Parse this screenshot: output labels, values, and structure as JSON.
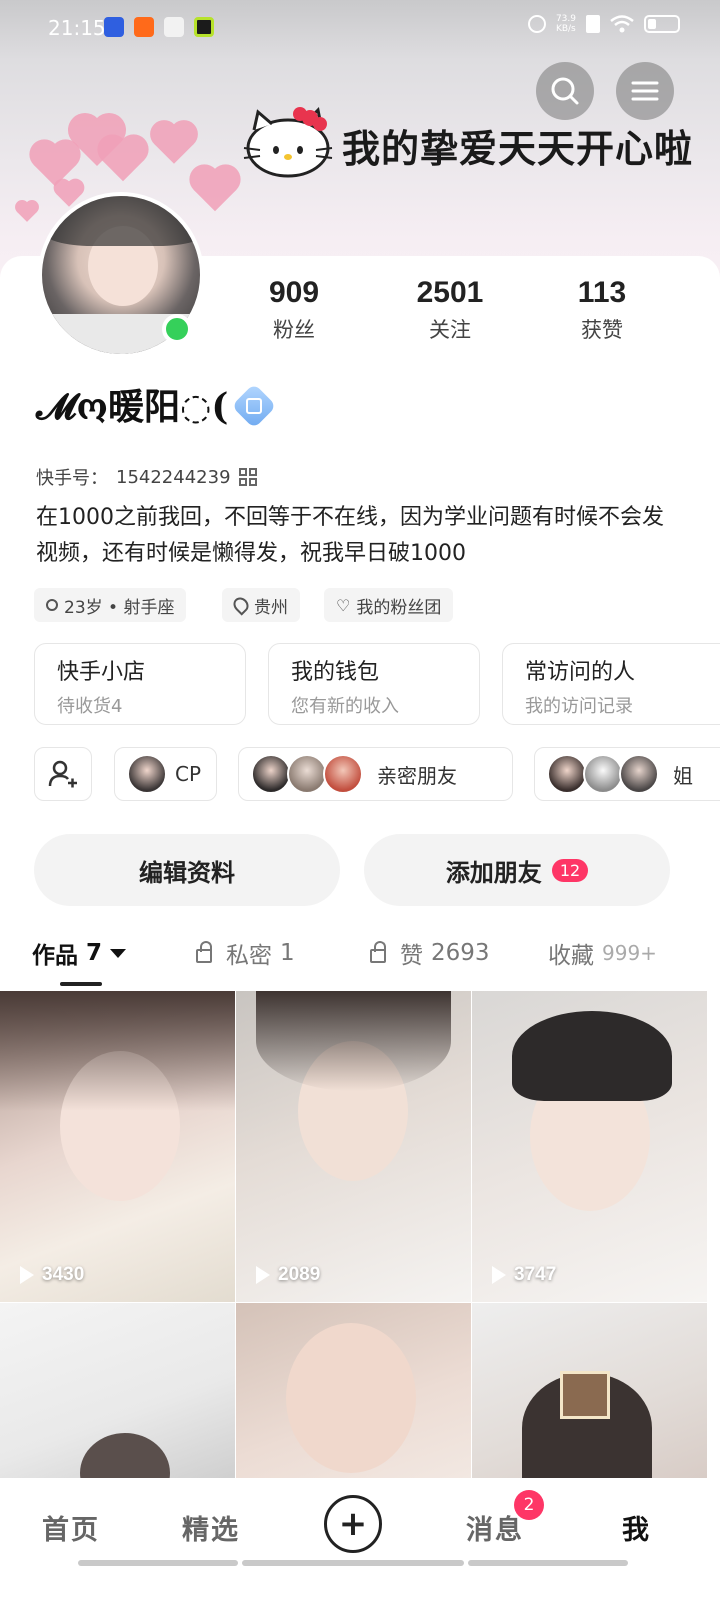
{
  "status_bar": {
    "time": "21:15",
    "net_speed": "73.9",
    "net_unit": "KB/s"
  },
  "banner": {
    "text": "我的挚爱天天开心啦"
  },
  "profile": {
    "followers_count": "909",
    "followers_label": "粉丝",
    "following_count": "2501",
    "following_label": "关注",
    "likes_count": "113",
    "likes_label": "获赞",
    "username": "𝓜ო暖阳◌(",
    "kuaishou_id_label": "快手号：",
    "kuaishou_id": "1542244239",
    "bio": "在1000之前我回，不回等于不在线，因为学业问题有时候不会发视频，还有时候是懒得发，祝我早日破1000",
    "tags": [
      "23岁 • 射手座",
      "贵州",
      "我的粉丝团"
    ]
  },
  "services": [
    {
      "title": "快手小店",
      "subtitle": "待收货4"
    },
    {
      "title": "我的钱包",
      "subtitle": "您有新的收入"
    },
    {
      "title": "常访问的人",
      "subtitle": "我的访问记录"
    }
  ],
  "friends": {
    "cp_label": "CP",
    "close_friends_label": "亲密朋友",
    "sister_label": "姐"
  },
  "actions": {
    "edit_profile": "编辑资料",
    "add_friend": "添加朋友",
    "add_friend_badge": "12"
  },
  "tabs": [
    {
      "label": "作品",
      "count": "7"
    },
    {
      "label": "私密",
      "count": "1"
    },
    {
      "label": "赞",
      "count": "2693"
    },
    {
      "label": "收藏",
      "count": "999+"
    }
  ],
  "videos": [
    {
      "views": "3430"
    },
    {
      "views": "2089"
    },
    {
      "views": "3747"
    },
    {
      "views": ""
    },
    {
      "views": ""
    },
    {
      "views": ""
    }
  ],
  "bottom_nav": {
    "home": "首页",
    "featured": "精选",
    "messages": "消息",
    "messages_badge": "2",
    "me": "我"
  },
  "colors": {
    "accent": "#fe3666",
    "online": "#35d05a"
  }
}
